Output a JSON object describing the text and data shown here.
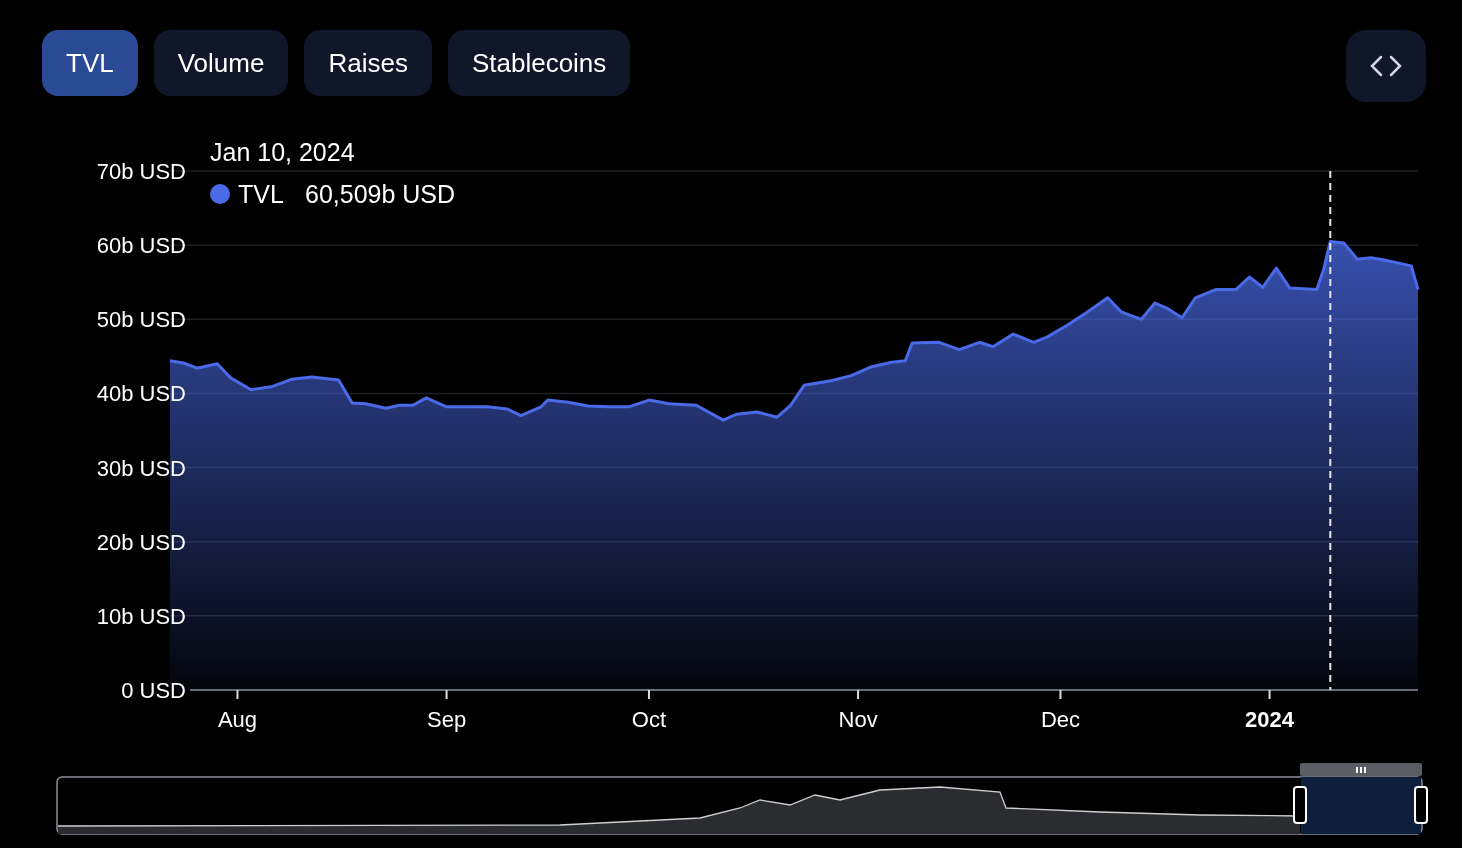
{
  "tabs": [
    {
      "label": "TVL",
      "selected": true
    },
    {
      "label": "Volume",
      "selected": false
    },
    {
      "label": "Raises",
      "selected": false
    },
    {
      "label": "Stablecoins",
      "selected": false
    }
  ],
  "chart": {
    "tooltip": {
      "date": "Jan 10, 2024",
      "value": "60,509b USD"
    },
    "chart_data": {
      "type": "area",
      "grid": true,
      "xlim": [
        "2023-07-22",
        "2024-01-23"
      ],
      "ylim": [
        0,
        70
      ],
      "xticks": [
        {
          "value": "2023-08-01",
          "label": "Aug"
        },
        {
          "value": "2023-09-01",
          "label": "Sep"
        },
        {
          "value": "2023-10-01",
          "label": "Oct"
        },
        {
          "value": "2023-11-01",
          "label": "Nov"
        },
        {
          "value": "2023-12-01",
          "label": "Dec"
        },
        {
          "value": "2024-01-01",
          "label": "2024"
        }
      ],
      "yticks": [
        {
          "value": 0,
          "label": "0 USD"
        },
        {
          "value": 10,
          "label": "10b USD"
        },
        {
          "value": 20,
          "label": "20b USD"
        },
        {
          "value": 30,
          "label": "30b USD"
        },
        {
          "value": 40,
          "label": "40b USD"
        },
        {
          "value": 50,
          "label": "50b USD"
        },
        {
          "value": 60,
          "label": "60b USD"
        },
        {
          "value": 70,
          "label": "70b USD"
        }
      ],
      "x": [
        "2023-07-22",
        "2023-07-24",
        "2023-07-26",
        "2023-07-29",
        "2023-07-31",
        "2023-08-03",
        "2023-08-06",
        "2023-08-09",
        "2023-08-12",
        "2023-08-16",
        "2023-08-18",
        "2023-08-20",
        "2023-08-23",
        "2023-08-25",
        "2023-08-27",
        "2023-08-29",
        "2023-09-01",
        "2023-09-04",
        "2023-09-07",
        "2023-09-10",
        "2023-09-12",
        "2023-09-15",
        "2023-09-16",
        "2023-09-19",
        "2023-09-22",
        "2023-09-25",
        "2023-09-28",
        "2023-10-01",
        "2023-10-04",
        "2023-10-08",
        "2023-10-12",
        "2023-10-14",
        "2023-10-17",
        "2023-10-20",
        "2023-10-22",
        "2023-10-24",
        "2023-10-28",
        "2023-10-31",
        "2023-11-03",
        "2023-11-06",
        "2023-11-08",
        "2023-11-09",
        "2023-11-13",
        "2023-11-16",
        "2023-11-19",
        "2023-11-21",
        "2023-11-24",
        "2023-11-27",
        "2023-11-29",
        "2023-12-02",
        "2023-12-05",
        "2023-12-08",
        "2023-12-10",
        "2023-12-13",
        "2023-12-15",
        "2023-12-17",
        "2023-12-19",
        "2023-12-21",
        "2023-12-24",
        "2023-12-27",
        "2023-12-29",
        "2023-12-31",
        "2024-01-02",
        "2024-01-04",
        "2024-01-08",
        "2024-01-09",
        "2024-01-10",
        "2024-01-12",
        "2024-01-14",
        "2024-01-16",
        "2024-01-18",
        "2024-01-20",
        "2024-01-22",
        "2024-01-23"
      ],
      "series": [
        {
          "name": "TVL",
          "color": "#4a6ae8",
          "values": [
            44.4,
            44.1,
            43.4,
            44.0,
            42.1,
            40.5,
            40.9,
            41.9,
            42.2,
            41.8,
            38.7,
            38.6,
            38.0,
            38.4,
            38.4,
            39.4,
            38.2,
            38.2,
            38.2,
            37.9,
            37.0,
            38.2,
            39.1,
            38.8,
            38.3,
            38.2,
            38.2,
            39.1,
            38.6,
            38.4,
            36.4,
            37.2,
            37.5,
            36.8,
            38.4,
            41.1,
            41.7,
            42.4,
            43.6,
            44.2,
            44.4,
            46.8,
            46.9,
            45.9,
            46.9,
            46.3,
            48.0,
            46.9,
            47.6,
            49.2,
            51.0,
            52.9,
            51.0,
            50.0,
            52.2,
            51.4,
            50.2,
            52.9,
            54.0,
            54.0,
            55.7,
            54.3,
            56.9,
            54.2,
            54.0,
            56.7,
            60.5,
            60.3,
            58.1,
            58.3,
            58.0,
            57.6,
            57.2,
            54.0
          ]
        }
      ],
      "ref_lines": [
        {
          "axis": "x",
          "value": "2024-01-10"
        }
      ]
    }
  }
}
